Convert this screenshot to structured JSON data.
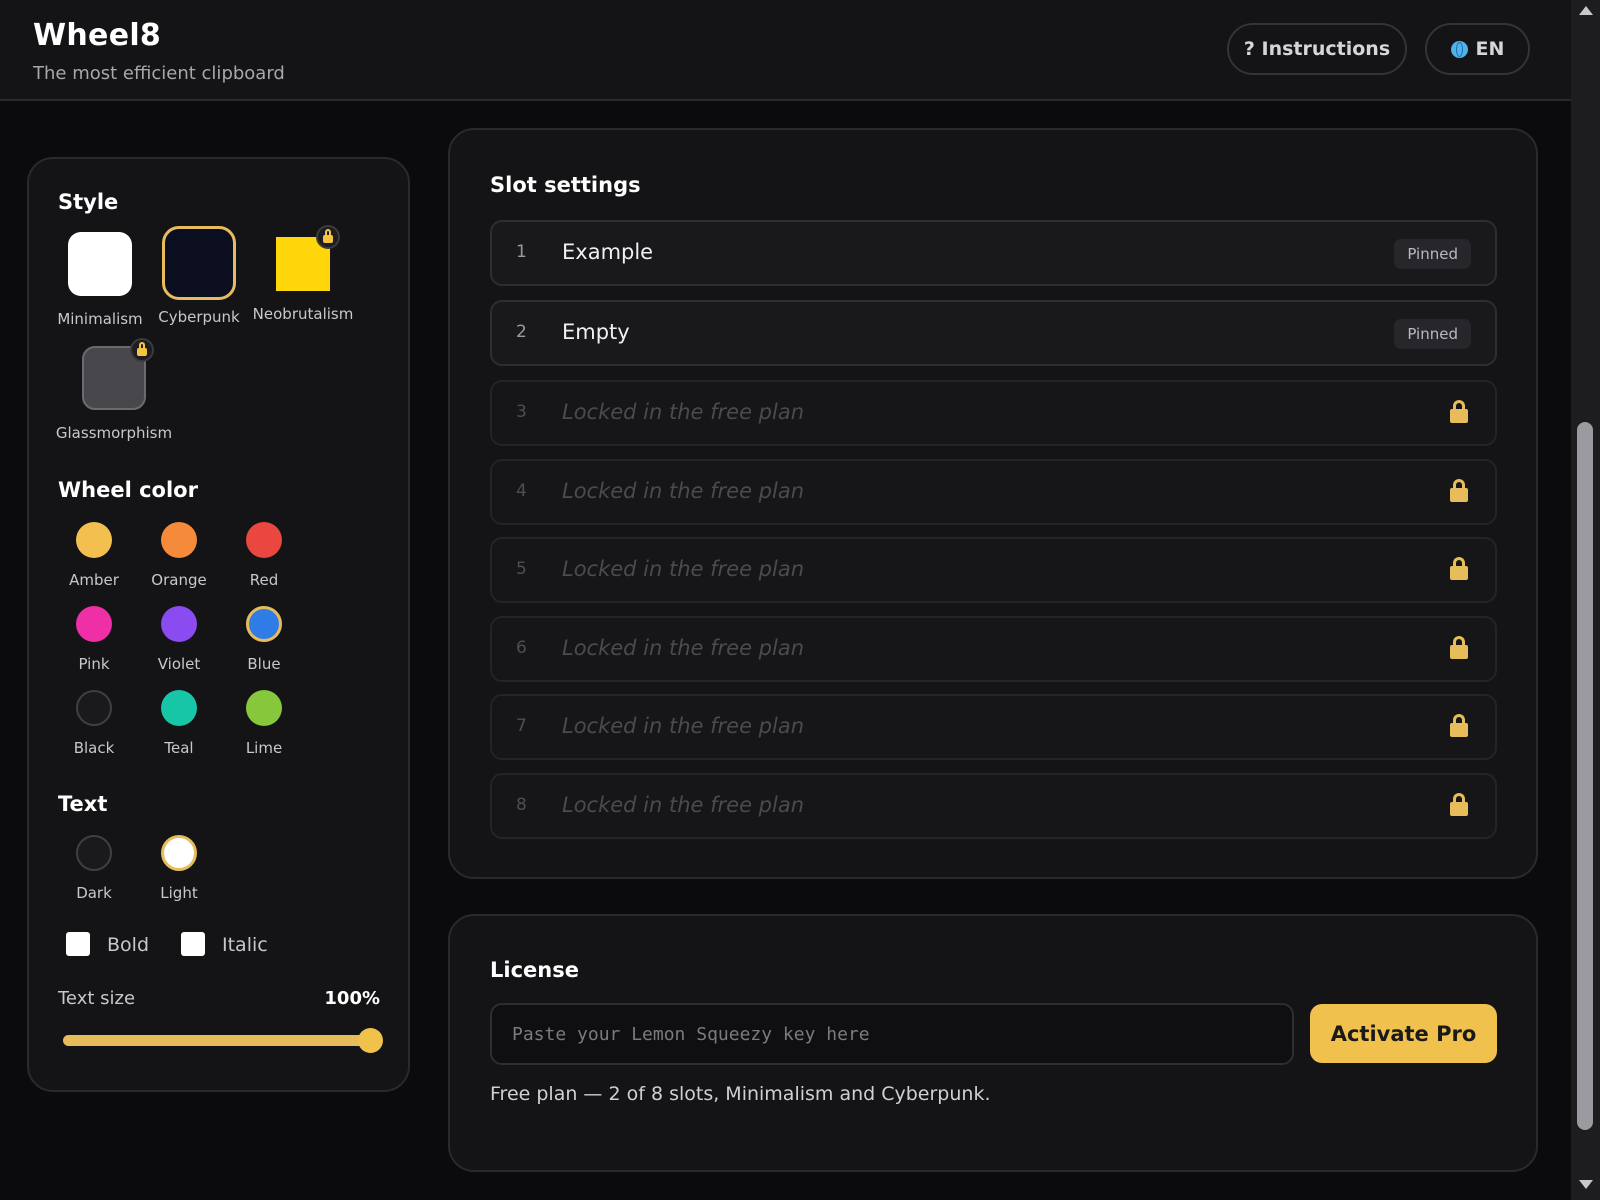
{
  "header": {
    "title": "Wheel8",
    "subtitle": "The most efficient clipboard",
    "instructions_label": "? Instructions",
    "language_label": "EN"
  },
  "style": {
    "heading": "Style",
    "options": [
      {
        "label": "Minimalism",
        "color": "#ffffff",
        "locked": false
      },
      {
        "label": "Cyberpunk",
        "color": "#0b0e1e",
        "locked": false,
        "selected": true
      },
      {
        "label": "Neobrutalism",
        "color": "#ffd60a",
        "locked": true
      },
      {
        "label": "Glassmorphism",
        "color": "#48484c",
        "locked": true
      }
    ]
  },
  "wheel_color": {
    "heading": "Wheel color",
    "options": [
      {
        "label": "Amber",
        "color": "#f3bf4f"
      },
      {
        "label": "Orange",
        "color": "#f58a3a"
      },
      {
        "label": "Red",
        "color": "#e9473f"
      },
      {
        "label": "Pink",
        "color": "#ee2fa6"
      },
      {
        "label": "Violet",
        "color": "#8a4bf0"
      },
      {
        "label": "Blue",
        "color": "#2f7ce6",
        "selected": true
      },
      {
        "label": "Black",
        "color": "#1a1a1d"
      },
      {
        "label": "Teal",
        "color": "#17c6a6"
      },
      {
        "label": "Lime",
        "color": "#86c73c"
      }
    ]
  },
  "text": {
    "heading": "Text",
    "options": [
      {
        "label": "Dark",
        "color": "#1a1a1d"
      },
      {
        "label": "Light",
        "color": "#ffffff",
        "selected": true
      }
    ],
    "bold_label": "Bold",
    "italic_label": "Italic",
    "size_label": "Text size",
    "size_value": "100%"
  },
  "slots": {
    "heading": "Slot settings",
    "items": [
      {
        "num": "1",
        "text": "Example",
        "badge": "Pinned",
        "locked": false
      },
      {
        "num": "2",
        "text": "Empty",
        "badge": "Pinned",
        "locked": false
      },
      {
        "num": "3",
        "text": "Locked in the free plan",
        "locked": true
      },
      {
        "num": "4",
        "text": "Locked in the free plan",
        "locked": true
      },
      {
        "num": "5",
        "text": "Locked in the free plan",
        "locked": true
      },
      {
        "num": "6",
        "text": "Locked in the free plan",
        "locked": true
      },
      {
        "num": "7",
        "text": "Locked in the free plan",
        "locked": true
      },
      {
        "num": "8",
        "text": "Locked in the free plan",
        "locked": true
      }
    ]
  },
  "license": {
    "heading": "License",
    "placeholder": "Paste your Lemon Squeezy key here",
    "activate_label": "Activate Pro",
    "note": "Free plan — 2 of 8 slots, Minimalism and Cyberpunk."
  },
  "colors": {
    "accent": "#f1c14e",
    "background": "#0b0b0d",
    "panel": "#141416"
  }
}
